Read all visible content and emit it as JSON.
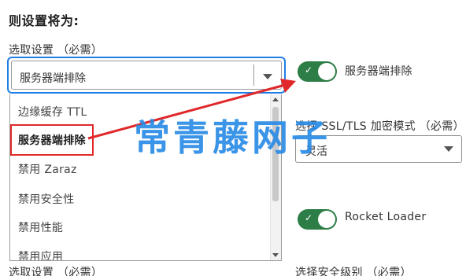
{
  "heading": "则设置将为:",
  "left_select": {
    "label": "选取设置 （必需）",
    "value": "服务器端排除"
  },
  "dropdown": {
    "items": [
      "边缘缓存 TTL",
      "服务器端排除",
      "禁用 Zaraz",
      "禁用安全性",
      "禁用性能",
      "禁用应用"
    ],
    "selected_index": 1
  },
  "toggle1": {
    "label": "服务器端排除",
    "checked": true,
    "check_glyph": "✓"
  },
  "ssl_select": {
    "label": "选择 SSL/TLS 加密模式 （必需）",
    "value": "灵活"
  },
  "toggle2": {
    "label": "Rocket Loader",
    "checked": true,
    "check_glyph": "✓"
  },
  "bottom_left_label": "选取设置 （必需）",
  "bottom_right_label": "选择安全级别 （必需）",
  "watermark": "常青藤网子",
  "colors": {
    "focus_blue": "#1f7ee6",
    "toggle_green": "#2d7d46",
    "highlight_red": "#e0282b",
    "watermark_blue": "#2a8be5"
  }
}
